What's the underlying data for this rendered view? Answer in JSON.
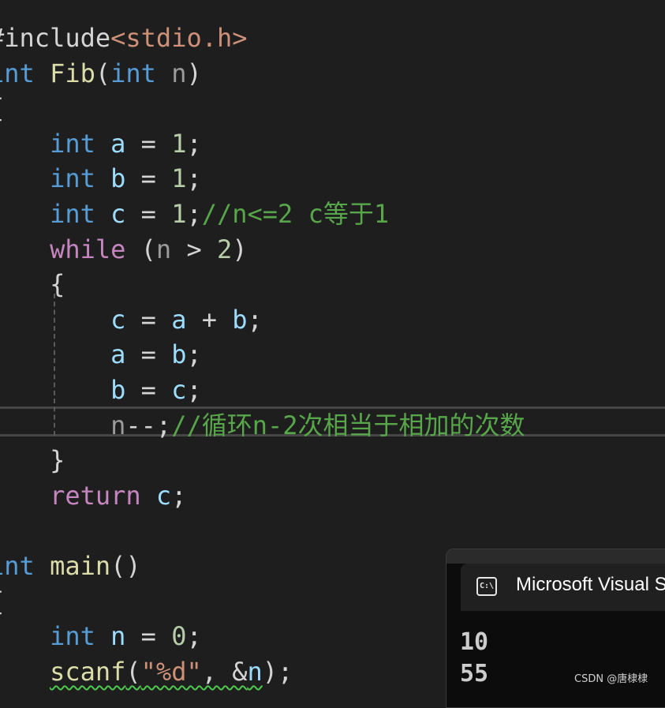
{
  "editor": {
    "lines": [
      [
        {
          "c": "tok-p",
          "t": "#include"
        },
        {
          "c": "tok-str",
          "t": "<stdio.h>"
        }
      ],
      [
        {
          "c": "tok-kw",
          "t": "int"
        },
        {
          "c": "tok-p",
          "t": " "
        },
        {
          "c": "tok-fn",
          "t": "Fib"
        },
        {
          "c": "tok-p",
          "t": "("
        },
        {
          "c": "tok-kw",
          "t": "int"
        },
        {
          "c": "tok-p",
          "t": " "
        },
        {
          "c": "tok-dim",
          "t": "n"
        },
        {
          "c": "tok-p",
          "t": ")"
        }
      ],
      [
        {
          "c": "tok-p",
          "t": "{"
        }
      ],
      [
        {
          "c": "tok-p",
          "t": "    "
        },
        {
          "c": "tok-kw",
          "t": "int"
        },
        {
          "c": "tok-p",
          "t": " "
        },
        {
          "c": "tok-id",
          "t": "a"
        },
        {
          "c": "tok-p",
          "t": " = "
        },
        {
          "c": "tok-num",
          "t": "1"
        },
        {
          "c": "tok-p",
          "t": ";"
        }
      ],
      [
        {
          "c": "tok-p",
          "t": "    "
        },
        {
          "c": "tok-kw",
          "t": "int"
        },
        {
          "c": "tok-p",
          "t": " "
        },
        {
          "c": "tok-id",
          "t": "b"
        },
        {
          "c": "tok-p",
          "t": " = "
        },
        {
          "c": "tok-num",
          "t": "1"
        },
        {
          "c": "tok-p",
          "t": ";"
        }
      ],
      [
        {
          "c": "tok-p",
          "t": "    "
        },
        {
          "c": "tok-kw",
          "t": "int"
        },
        {
          "c": "tok-p",
          "t": " "
        },
        {
          "c": "tok-id",
          "t": "c"
        },
        {
          "c": "tok-p",
          "t": " = "
        },
        {
          "c": "tok-num",
          "t": "1"
        },
        {
          "c": "tok-p",
          "t": ";"
        },
        {
          "c": "tok-cmt",
          "t": "//n<=2 c等于1"
        }
      ],
      [
        {
          "c": "tok-p",
          "t": "    "
        },
        {
          "c": "tok-ctl",
          "t": "while"
        },
        {
          "c": "tok-p",
          "t": " ("
        },
        {
          "c": "tok-dim",
          "t": "n"
        },
        {
          "c": "tok-p",
          "t": " > "
        },
        {
          "c": "tok-num",
          "t": "2"
        },
        {
          "c": "tok-p",
          "t": ")"
        }
      ],
      [
        {
          "c": "tok-p",
          "t": "    {"
        }
      ],
      [
        {
          "c": "tok-p",
          "t": "        "
        },
        {
          "c": "tok-id",
          "t": "c"
        },
        {
          "c": "tok-p",
          "t": " = "
        },
        {
          "c": "tok-id",
          "t": "a"
        },
        {
          "c": "tok-p",
          "t": " + "
        },
        {
          "c": "tok-id",
          "t": "b"
        },
        {
          "c": "tok-p",
          "t": ";"
        }
      ],
      [
        {
          "c": "tok-p",
          "t": "        "
        },
        {
          "c": "tok-id",
          "t": "a"
        },
        {
          "c": "tok-p",
          "t": " = "
        },
        {
          "c": "tok-id",
          "t": "b"
        },
        {
          "c": "tok-p",
          "t": ";"
        }
      ],
      [
        {
          "c": "tok-p",
          "t": "        "
        },
        {
          "c": "tok-id",
          "t": "b"
        },
        {
          "c": "tok-p",
          "t": " = "
        },
        {
          "c": "tok-id",
          "t": "c"
        },
        {
          "c": "tok-p",
          "t": ";"
        }
      ],
      [
        {
          "c": "tok-p",
          "t": "        "
        },
        {
          "c": "tok-dim",
          "t": "n"
        },
        {
          "c": "tok-p",
          "t": "--;"
        },
        {
          "c": "tok-cmt",
          "t": "//循环n-2次相当于相加的次数"
        }
      ],
      [
        {
          "c": "tok-p",
          "t": "    }"
        }
      ],
      [
        {
          "c": "tok-p",
          "t": "    "
        },
        {
          "c": "tok-ctl",
          "t": "return"
        },
        {
          "c": "tok-p",
          "t": " "
        },
        {
          "c": "tok-id",
          "t": "c"
        },
        {
          "c": "tok-p",
          "t": ";"
        }
      ],
      [],
      [
        {
          "c": "tok-kw",
          "t": "int"
        },
        {
          "c": "tok-p",
          "t": " "
        },
        {
          "c": "tok-fn",
          "t": "main"
        },
        {
          "c": "tok-p",
          "t": "()"
        }
      ],
      [
        {
          "c": "tok-p",
          "t": "{"
        }
      ],
      [
        {
          "c": "tok-p",
          "t": "    "
        },
        {
          "c": "tok-kw",
          "t": "int"
        },
        {
          "c": "tok-p",
          "t": " "
        },
        {
          "c": "tok-id",
          "t": "n"
        },
        {
          "c": "tok-p",
          "t": " = "
        },
        {
          "c": "tok-num",
          "t": "0"
        },
        {
          "c": "tok-p",
          "t": ";"
        }
      ],
      [
        {
          "c": "tok-p",
          "t": "    "
        },
        {
          "c": "tok-fn squiggle",
          "t": "scanf"
        },
        {
          "c": "tok-p squiggle",
          "t": "("
        },
        {
          "c": "tok-str squiggle",
          "t": "\"%d\""
        },
        {
          "c": "tok-p squiggle",
          "t": ", &"
        },
        {
          "c": "tok-id squiggle",
          "t": "n"
        },
        {
          "c": "tok-p",
          "t": ");"
        }
      ]
    ]
  },
  "console": {
    "title": "Microsoft Visual Studio Debug Console",
    "icon": "terminal-icon",
    "icon_glyph": "C:\\",
    "output": [
      "10",
      "55"
    ]
  },
  "watermark": "CSDN @唐棣棣"
}
